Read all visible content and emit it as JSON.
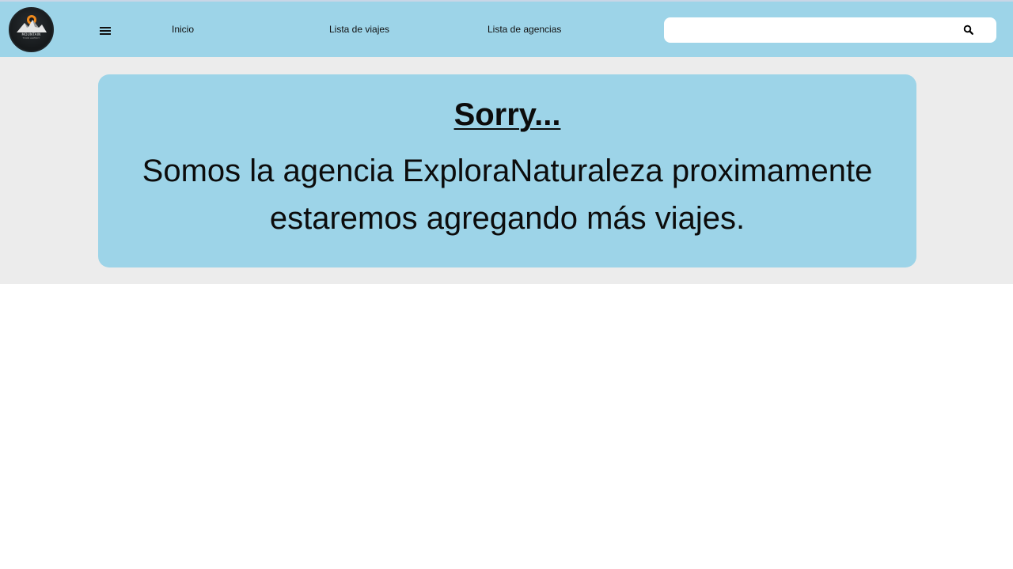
{
  "header": {
    "logo_text": "MOUNTAIN",
    "logo_subtext": "TOUR AGENCY",
    "nav": [
      {
        "label": "Inicio"
      },
      {
        "label": "Lista de viajes"
      },
      {
        "label": "Lista de agencias"
      }
    ],
    "search": {
      "value": "",
      "placeholder": ""
    },
    "menu_icon": "hamburger-icon",
    "search_icon": "search-icon"
  },
  "main": {
    "title": "Sorry...",
    "message": "Somos la agencia ExploraNaturaleza proximamente estaremos agregando más viajes."
  },
  "colors": {
    "header_bg": "#9dd4e8",
    "band_bg": "#ececec",
    "card_bg": "#9dd4e8"
  }
}
